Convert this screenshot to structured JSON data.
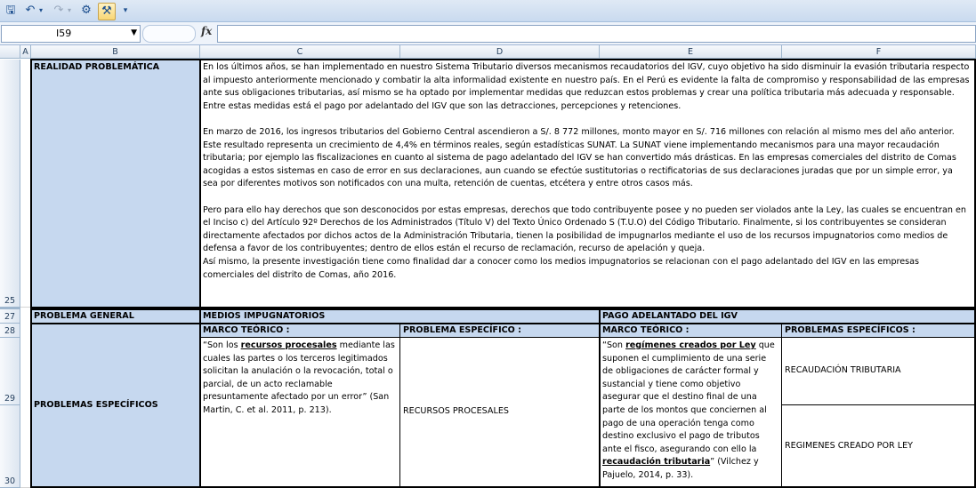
{
  "formula_bar": {
    "name_box": "I59",
    "fx_label": "fx",
    "formula": ""
  },
  "columns": [
    "A",
    "B",
    "C",
    "D",
    "E",
    "F"
  ],
  "rows": [
    "25",
    "27",
    "28",
    "29",
    "30"
  ],
  "cells": {
    "b25": "REALIDAD PROBLEMÁTICA",
    "c25_p1": "En los últimos años, se han implementado en nuestro Sistema Tributario diversos mecanismos recaudatorios del IGV, cuyo objetivo ha sido disminuir la evasión tributaria respecto al impuesto anteriormente mencionado y combatir la alta informalidad existente en nuestro país. En el Perú es evidente la falta de compromiso y responsabilidad de las empresas ante sus obligaciones tributarias, así mismo se ha optado por implementar medidas que reduzcan estos problemas y crear una política tributaria más adecuada y responsable. Entre estas medidas está el pago por adelantado del IGV que son las detracciones, percepciones y retenciones.",
    "c25_p2": "En marzo de 2016, los ingresos tributarios del Gobierno Central ascendieron a S/. 8 772 millones, monto mayor en S/. 716 millones con relación al mismo mes del año anterior. Este resultado representa un crecimiento de 4,4% en términos reales, según estadísticas SUNAT. La SUNAT viene implementando mecanismos para una mayor recaudación tributaria; por ejemplo las fiscalizaciones en cuanto al sistema de pago adelantado del IGV se han convertido más drásticas. En las empresas comerciales del distrito de Comas acogidas a estos sistemas en caso de error en sus declaraciones, aun cuando se efectúe sustitutorias o rectificatorias de sus declaraciones juradas que por un simple error, ya sea por diferentes motivos son notificados con una multa, retención de cuentas, etcétera y entre otros casos más.",
    "c25_p3": "Pero para ello hay derechos que son desconocidos por estas empresas, derechos que todo contribuyente posee y no pueden ser violados ante la Ley, las cuales se encuentran en el Inciso c) del Artículo 92º Derechos de los Administrados (Título V) del Texto Único Ordenado S (T.U.O) del Código Tributario. Finalmente, si los contribuyentes se consideran directamente afectados por dichos actos de la Administración Tributaria, tienen la posibilidad de impugnarlos mediante el uso de los recursos impugnatorios como medios de defensa a favor de los contribuyentes; dentro de ellos están el recurso de reclamación, recurso de apelación y queja.",
    "c25_p4": "Así mismo, la presente investigación tiene como finalidad dar a conocer como los medios impugnatorios se relacionan con el pago adelantado del IGV en las empresas comerciales del distrito de Comas, año 2016.",
    "b27": "PROBLEMA GENERAL",
    "c27": "MEDIOS IMPUGNATORIOS",
    "e27": "PAGO ADELANTADO DEL IGV",
    "b29": "PROBLEMAS ESPECÍFICOS",
    "c28": "MARCO TEÓRICO :",
    "d28": "PROBLEMA ESPECÍFICO :",
    "e28": "MARCO TEÓRICO :",
    "f28": "PROBLEMAS ESPECÍFICOS :",
    "c29_a": "“Son los ",
    "c29_b": "recursos procesales",
    "c29_c": " mediante las cuales las partes o los terceros legitimados solicitan la anulación o la revocación, total o parcial, de un acto reclamable presuntamente afectado por un error” (San Martin, C. et al. 2011, p. 213).",
    "d29": "RECURSOS PROCESALES",
    "e29_a": "“Son ",
    "e29_b": "regímenes creados por Ley",
    "e29_c": " que suponen el cumplimiento de una serie de obligaciones de carácter formal y sustancial y tiene como objetivo asegurar que el destino final de una parte de los montos que conciernen al pago de una operación tenga como destino exclusivo el pago de tributos ante el fisco, asegurando con ello la ",
    "e29_d": "recaudación tributaria",
    "e29_e": "” (Vilchez y Pajuelo, 2014, p. 33).",
    "f29": "RECAUDACIÓN TRIBUTARIA",
    "f30": "REGIMENES CREADO POR LEY"
  }
}
